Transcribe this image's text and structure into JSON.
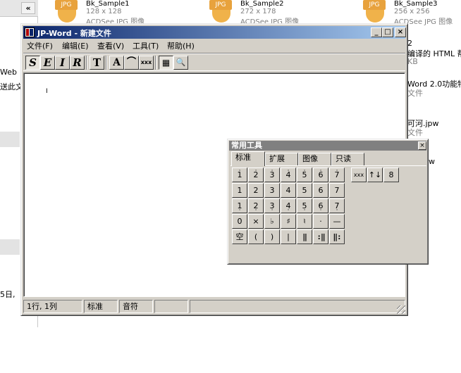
{
  "background": {
    "left_text": [
      "Web",
      "送此文",
      "5日,"
    ],
    "files": [
      {
        "name": "Bk_Sample1",
        "dims": "128 x 128",
        "kind": "ACDSee JPG 图像",
        "badge": "JPG"
      },
      {
        "name": "Bk_Sample2",
        "dims": "272 x 178",
        "kind": "ACDSee JPG 图像",
        "badge": "JPG"
      },
      {
        "name": "Bk_Sample3",
        "dims": "256 x 256",
        "kind": "ACDSee JPG 图像",
        "badge": "JPG"
      }
    ],
    "right_text": [
      "2",
      "编译的 HTML 帮",
      "KB",
      "Word 2.0功能特",
      "文件",
      "可河.jpw",
      "文件",
      "w"
    ]
  },
  "window": {
    "title": "JP-Word - 新建文件",
    "caption": {
      "min": "_",
      "max": "□",
      "close": "×"
    }
  },
  "menu": [
    "文件(F)",
    "编辑(E)",
    "查看(V)",
    "工具(T)",
    "帮助(H)"
  ],
  "toolbar": {
    "buttons": [
      "S",
      "E",
      "I",
      "R",
      "T",
      "A",
      "⌒",
      "xxx",
      "▦",
      "🔍"
    ]
  },
  "editor": {
    "cursor": "I"
  },
  "status": {
    "position": "1行, 1列",
    "mode": "标准",
    "type": "音符"
  },
  "palette": {
    "title": "常用工具",
    "close": "×",
    "tabs": [
      "标准",
      "扩展",
      "图像",
      "只读"
    ],
    "active_tab": "标准",
    "row1": [
      "1",
      "2",
      "3",
      "4",
      "5",
      "6",
      "7"
    ],
    "row2": [
      "1",
      "2",
      "3",
      "4",
      "5",
      "6",
      "7"
    ],
    "row3": [
      "1",
      "2",
      "3",
      "4",
      "5",
      "6",
      "7"
    ],
    "row4": [
      "0",
      "×",
      "♭",
      "♯",
      "♮",
      "·",
      "—"
    ],
    "row5": [
      "空",
      "(",
      ")",
      "|",
      "‖",
      ":‖",
      "‖:"
    ],
    "extra": [
      "xxx",
      "↑↓",
      "8"
    ]
  }
}
